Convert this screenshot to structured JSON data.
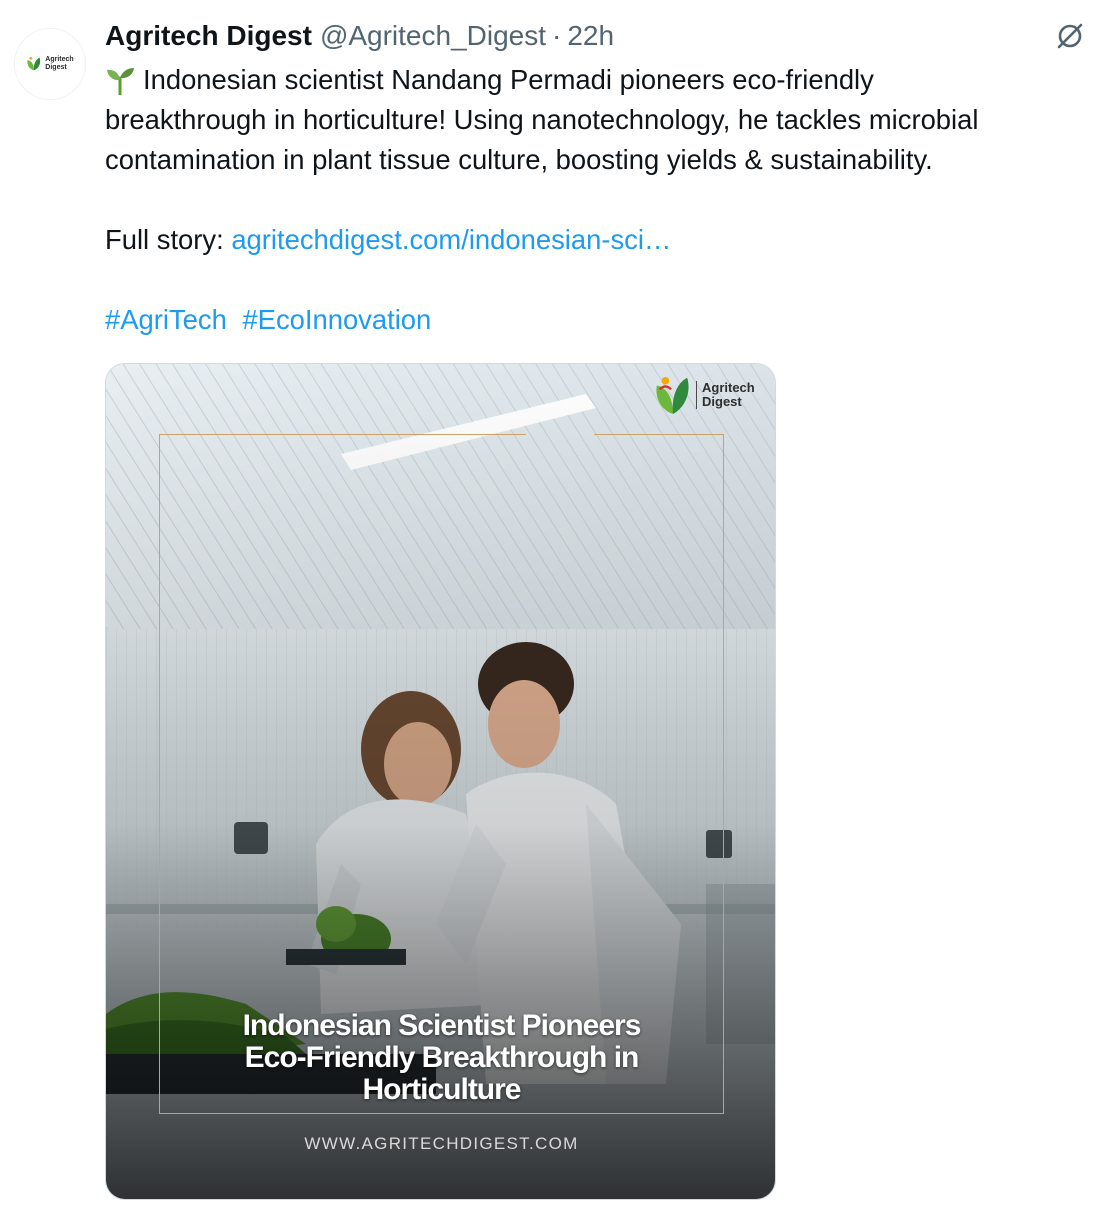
{
  "account": {
    "display_name": "Agritech Digest",
    "handle": "@Agritech_Digest",
    "separator": "·",
    "time": "22h",
    "avatar_text_line1": "Agritech",
    "avatar_text_line2": "Digest"
  },
  "tweet": {
    "line1": "Indonesian scientist Nandang Permadi pioneers eco-friendly",
    "line2": "breakthrough in horticulture! Using nanotechnology, he tackles microbial",
    "line3": "contamination in plant tissue culture, boosting yields & sustainability.",
    "full_story_label": "Full story: ",
    "link_text": "agritechdigest.com/indonesian-sci…",
    "hashtags": [
      "#AgriTech",
      "#EcoInnovation"
    ],
    "emoji_icon": "seedling-icon"
  },
  "media": {
    "brand_line1": "Agritech",
    "brand_line2": "Digest",
    "headline_line1": "Indonesian Scientist Pioneers",
    "headline_line2": "Eco-Friendly Breakthrough in",
    "headline_line3": "Horticulture",
    "website": "WWW.AGRITECHDIGEST.COM"
  },
  "icons": {
    "more": "grok-slash-circle-icon"
  },
  "colors": {
    "link": "#1d9bf0",
    "secondary_text": "#536471",
    "frame_gold": "#c9a26a"
  }
}
